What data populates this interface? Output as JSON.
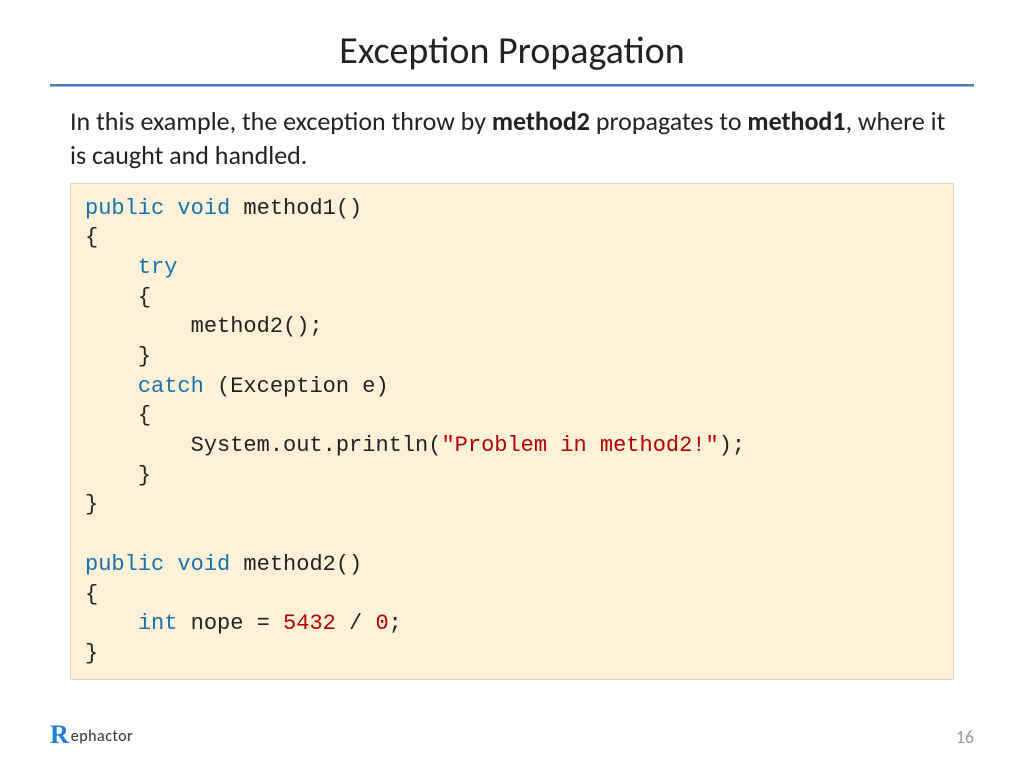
{
  "title": "Exception Propagation",
  "intro": {
    "pre": "In this example, the exception throw by ",
    "b1": "method2",
    "mid": " propagates to ",
    "b2": "method1",
    "post": ", where it is caught and handled."
  },
  "code": {
    "kw_public1": "public",
    "kw_void1": "void",
    "m1_sig": " method1()",
    "lbrace": "{",
    "rbrace": "}",
    "kw_try": "try",
    "call_m2": "        method2();",
    "kw_catch": "catch",
    "catch_rest": " (Exception e)",
    "println_pre": "        System.out.println(",
    "println_str": "\"Problem in method2!\"",
    "println_post": ");",
    "kw_public2": "public",
    "kw_void2": "void",
    "m2_sig": " method2()",
    "kw_int": "int",
    "nope_mid": " nope = ",
    "nope_n1": "5432",
    "nope_div": " / ",
    "nope_n2": "0",
    "nope_end": ";"
  },
  "footer": {
    "logo_r": "R",
    "logo_rest": "ephactor",
    "page": "16"
  }
}
